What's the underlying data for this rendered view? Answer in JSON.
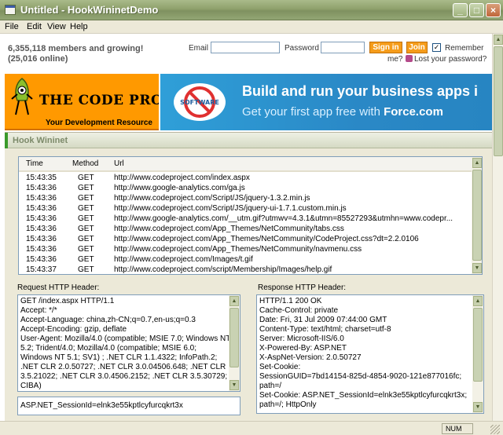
{
  "window": {
    "title": "Untitled - HookWininetDemo"
  },
  "menu": [
    "File",
    "Edit",
    "View",
    "Help"
  ],
  "site": {
    "members_line1": "6,355,118 members and growing!",
    "members_line2": "(25,016 online)",
    "email_label": "Email",
    "password_label": "Password",
    "signin_label": "Sign in",
    "join_label": "Join",
    "remember_label": "Remember",
    "remember_label2": "me?",
    "lost_password": "Lost your password?",
    "banner_logo": "THE CODE PROJECT",
    "banner_sub": "Your Development Resource",
    "ad_line1": "Build and run your business apps i",
    "ad_line2_prefix": "Get your first app free with ",
    "ad_line2_brand": "Force.com"
  },
  "panel": {
    "title": "Hook Wininet",
    "columns": {
      "time": "Time",
      "method": "Method",
      "url": "Url"
    },
    "rows": [
      {
        "time": "15:43:35",
        "method": "GET",
        "url": "http://www.codeproject.com/index.aspx"
      },
      {
        "time": "15:43:36",
        "method": "GET",
        "url": "http://www.google-analytics.com/ga.js"
      },
      {
        "time": "15:43:36",
        "method": "GET",
        "url": "http://www.codeproject.com/Script/JS/jquery-1.3.2.min.js"
      },
      {
        "time": "15:43:36",
        "method": "GET",
        "url": "http://www.codeproject.com/Script/JS/jquery-ui-1.7.1.custom.min.js"
      },
      {
        "time": "15:43:36",
        "method": "GET",
        "url": "http://www.google-analytics.com/__utm.gif?utmwv=4.3.1&utmn=85527293&utmhn=www.codepr..."
      },
      {
        "time": "15:43:36",
        "method": "GET",
        "url": "http://www.codeproject.com/App_Themes/NetCommunity/tabs.css"
      },
      {
        "time": "15:43:36",
        "method": "GET",
        "url": "http://www.codeproject.com/App_Themes/NetCommunity/CodeProject.css?dt=2.2.0106"
      },
      {
        "time": "15:43:36",
        "method": "GET",
        "url": "http://www.codeproject.com/App_Themes/NetCommunity/navmenu.css"
      },
      {
        "time": "15:43:36",
        "method": "GET",
        "url": "http://www.codeproject.com/Images/t.gif"
      },
      {
        "time": "15:43:37",
        "method": "GET",
        "url": "http://www.codeproject.com/script/Membership/Images/help.gif"
      }
    ],
    "request_label": "Request HTTP Header:",
    "response_label": "Response HTTP Header:",
    "request_lines": [
      "GET /index.aspx HTTP/1.1",
      "Accept: */*",
      "Accept-Language: china,zh-CN;q=0.7,en-us;q=0.3",
      "Accept-Encoding: gzip, deflate",
      "User-Agent: Mozilla/4.0 (compatible; MSIE 7.0; Windows NT",
      "5.2; Trident/4.0; Mozilla/4.0 (compatible; MSIE 6.0;",
      "Windows NT 5.1; SV1) ; .NET CLR 1.1.4322; InfoPath.2;",
      ".NET CLR 2.0.50727; .NET CLR 3.0.04506.648; .NET CLR",
      "3.5.21022; .NET CLR 3.0.4506.2152; .NET CLR 3.5.30729;",
      "CIBA)"
    ],
    "response_lines": [
      "HTTP/1.1 200 OK",
      "Cache-Control: private",
      "Date: Fri, 31 Jul 2009 07:44:00 GMT",
      "Content-Type: text/html; charset=utf-8",
      "Server: Microsoft-IIS/6.0",
      "X-Powered-By: ASP.NET",
      "X-AspNet-Version: 2.0.50727",
      "Set-Cookie:",
      "SessionGUID=7bd14154-825d-4854-9020-121e877016fc;",
      "path=/",
      "Set-Cookie: ASP.NET_SessionId=elnk3e55kptlcyfurcqkrt3x;",
      "path=/; HttpOnly"
    ],
    "cookie_value": "ASP.NET_SessionId=elnk3e55kptlcyfurcqkrt3x"
  },
  "status": {
    "num": "NUM"
  },
  "colors": {
    "accent_orange": "#f59c1a",
    "titlebar_green": "#8fa16c",
    "ad_blue": "#2a88c6"
  }
}
